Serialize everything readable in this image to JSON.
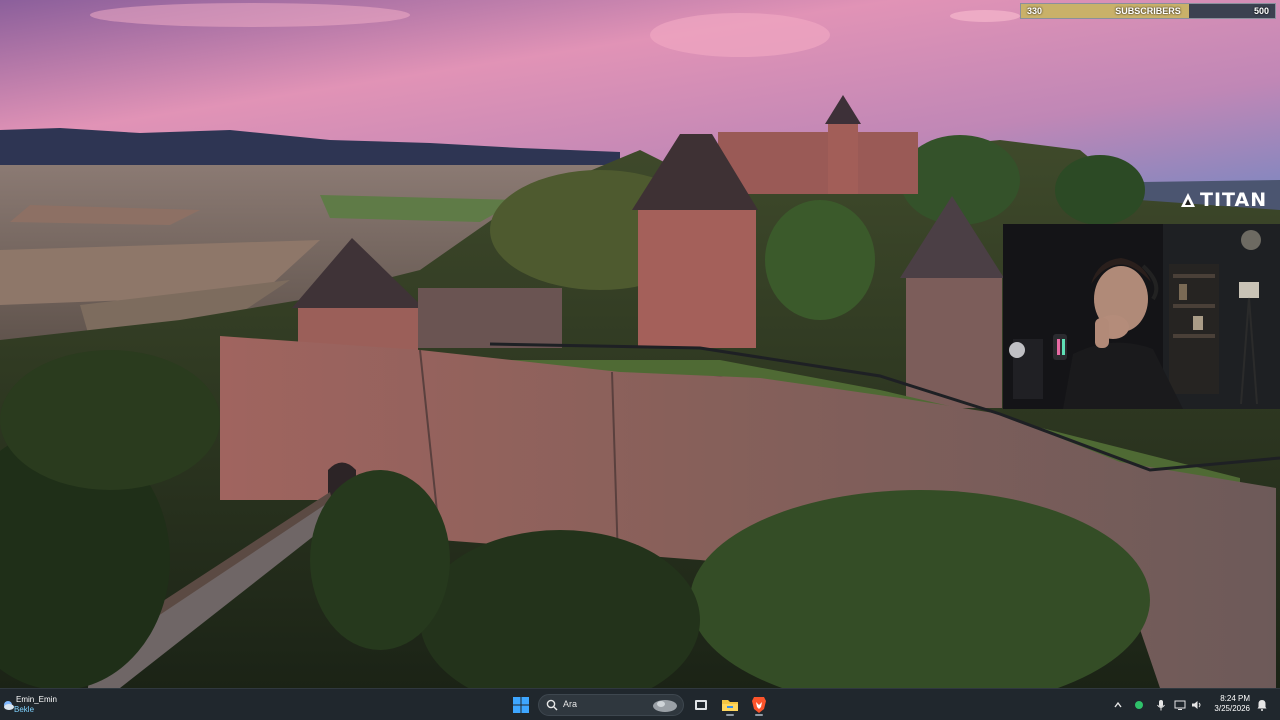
{
  "overlay": {
    "subscriber_goal": {
      "current": "330",
      "label": "SUBSCRIBERS",
      "goal": "500",
      "progress": 0.66
    },
    "brand_logo": {
      "text": "TITAN",
      "icon": "titan-logo-icon"
    }
  },
  "webcam": {
    "content": "streamer-camera-feed"
  },
  "taskbar": {
    "widget": {
      "line1": "Emin_Emin",
      "line2": "Bekle",
      "icon": "weather-icon"
    },
    "start_icon": "windows-start-icon",
    "search": {
      "placeholder": "Ara",
      "icon": "search-icon"
    },
    "pinned": [
      {
        "name": "task-view-icon"
      },
      {
        "name": "file-explorer-icon"
      },
      {
        "name": "brave-browser-icon"
      }
    ],
    "tray": {
      "icons": [
        "chevron-up-icon",
        "status-dot-icon",
        "microphone-icon",
        "display-icon",
        "speaker-icon"
      ],
      "time": "8:24 PM",
      "date": "3/25/2026",
      "notification_icon": "notification-bell-icon"
    }
  },
  "colors": {
    "sky_top": "#8a5e9c",
    "sky_pink": "#e396b8",
    "sky_right": "#7f86c0",
    "castle_stone": "#8b6159",
    "goal_fill": "#c9b169",
    "taskbar_bg": "#20272d"
  }
}
